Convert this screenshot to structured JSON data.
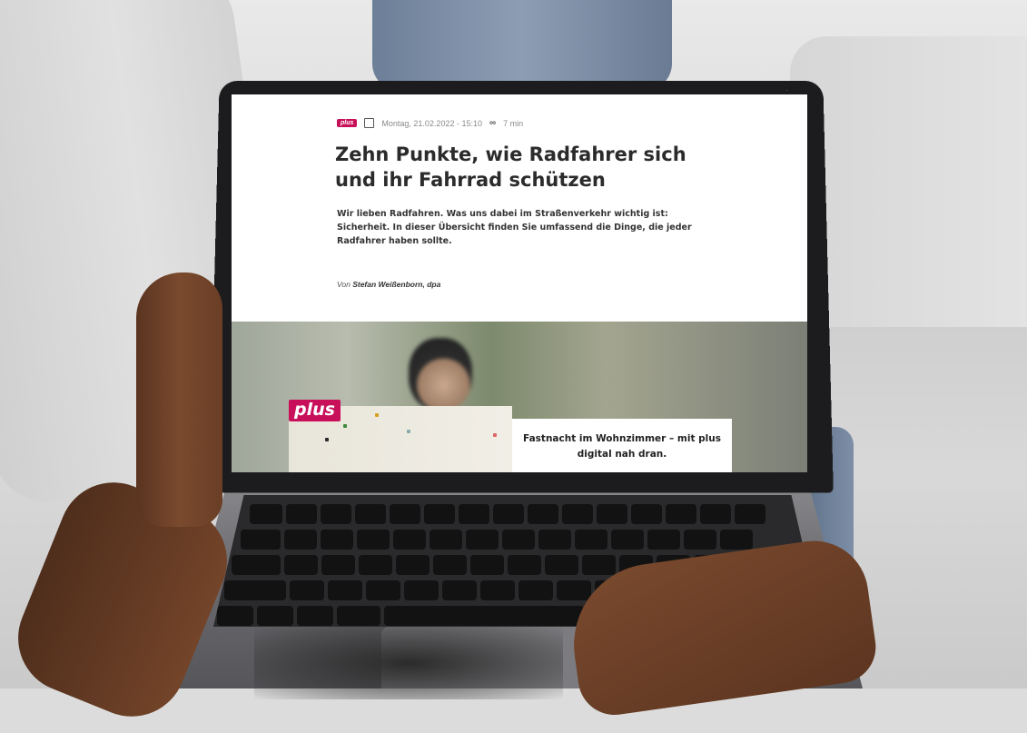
{
  "article": {
    "badge": "plus",
    "date": "Montag, 21.02.2022 - 15:10",
    "read_time": "7 min",
    "headline": "Zehn Punkte, wie Radfahrer sich und ihr Fahrrad schützen",
    "teaser": "Wir lieben Radfahren. Was uns dabei im Straßenverkehr wichtig ist: Sicherheit. In dieser Übersicht finden Sie umfassend die Dinge, die jeder Radfahrer haben sollte.",
    "byline_prefix": "Von",
    "author": "Stefan Weißenborn, dpa"
  },
  "promo": {
    "badge": "plus",
    "text": "Fastnacht im Wohnzimmer – mit plus digital nah dran."
  },
  "colors": {
    "brand": "#c8105a"
  },
  "icons": [
    "calendar-icon",
    "glasses-icon"
  ]
}
